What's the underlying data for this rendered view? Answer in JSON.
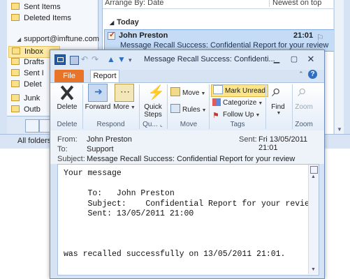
{
  "outlook": {
    "folders": {
      "sent_items": "Sent Items",
      "deleted_items": "Deleted Items",
      "account": "support@imftune.com",
      "inbox": "Inbox",
      "drafts": "Drafts",
      "sent_short": "Sent I",
      "deleted_short": "Delet",
      "junk": "Junk",
      "outbox": "Outb"
    },
    "status_bar": "All folders a",
    "mail_list": {
      "arrange_by": "Arrange By: Date",
      "order": "Newest on top",
      "group": "Today",
      "message": {
        "from": "John Preston",
        "time": "21:01",
        "subject": "Message Recall Success: Confidential Report for your review"
      }
    }
  },
  "window": {
    "title": "Message Recall Success: Confidenti...",
    "tabs": {
      "file": "File",
      "report": "Report"
    },
    "ribbon": {
      "delete": "Delete",
      "forward": "Forward",
      "more": "More",
      "quick_steps": "Quick Steps",
      "move": "Move",
      "rules": "Rules",
      "mark_unread": "Mark Unread",
      "categorize": "Categorize",
      "follow_up": "Follow Up",
      "find": "Find",
      "zoom": "Zoom",
      "groups": {
        "delete": "Delete",
        "respond": "Respond",
        "quick": "Qu...",
        "move": "Move",
        "tags": "Tags",
        "find": "",
        "zoom": "Zoom"
      }
    },
    "headers": {
      "from_label": "From:",
      "from_value": "John Preston",
      "to_label": "To:",
      "to_value": "Support",
      "subject_label": "Subject:",
      "subject_value": "Message Recall Success: Confidential Report for your review",
      "sent_label": "Sent:",
      "sent_value": "Fri 13/05/2011 21:01"
    },
    "body": "Your message\n\n     To:   John Preston\n     Subject:    Confidential Report for your review\n     Sent: 13/05/2011 21:00\n\n\n\nwas recalled successfully on 13/05/2011 21:01."
  }
}
